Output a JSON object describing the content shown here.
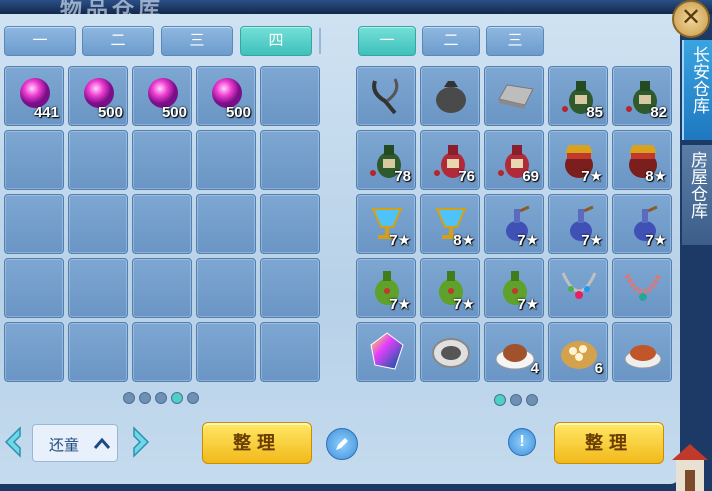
{
  "window": {
    "title": "物品仓库",
    "close_label": "✕"
  },
  "colors": {
    "tab_active": "#3fc0bb",
    "button_gold": "#f2b91b",
    "panel": "#c5dbee"
  },
  "left_tabs": [
    {
      "label": "一",
      "active": false
    },
    {
      "label": "二",
      "active": false
    },
    {
      "label": "三",
      "active": false
    },
    {
      "label": "四",
      "active": true
    }
  ],
  "right_tabs": [
    {
      "label": "一",
      "active": true
    },
    {
      "label": "二",
      "active": false
    },
    {
      "label": "三",
      "active": false
    }
  ],
  "left_grid": [
    {
      "icon": "magenta-gem-orb-icon",
      "count": "441"
    },
    {
      "icon": "magenta-gem-orb-icon",
      "count": "500"
    },
    {
      "icon": "magenta-gem-orb-icon",
      "count": "500"
    },
    {
      "icon": "magenta-gem-orb-icon",
      "count": "500"
    },
    {
      "icon": "",
      "count": ""
    },
    {
      "icon": "",
      "count": ""
    },
    {
      "icon": "",
      "count": ""
    },
    {
      "icon": "",
      "count": ""
    },
    {
      "icon": "",
      "count": ""
    },
    {
      "icon": "",
      "count": ""
    },
    {
      "icon": "",
      "count": ""
    },
    {
      "icon": "",
      "count": ""
    },
    {
      "icon": "",
      "count": ""
    },
    {
      "icon": "",
      "count": ""
    },
    {
      "icon": "",
      "count": ""
    },
    {
      "icon": "",
      "count": ""
    },
    {
      "icon": "",
      "count": ""
    },
    {
      "icon": "",
      "count": ""
    },
    {
      "icon": "",
      "count": ""
    },
    {
      "icon": "",
      "count": ""
    },
    {
      "icon": "",
      "count": ""
    },
    {
      "icon": "",
      "count": ""
    },
    {
      "icon": "",
      "count": ""
    },
    {
      "icon": "",
      "count": ""
    },
    {
      "icon": "",
      "count": ""
    }
  ],
  "right_grid": [
    {
      "icon": "slingshot-icon",
      "count": ""
    },
    {
      "icon": "cloth-pouch-icon",
      "count": ""
    },
    {
      "icon": "silver-bar-icon",
      "count": ""
    },
    {
      "icon": "green-wine-jar-icon",
      "count": "85"
    },
    {
      "icon": "green-wine-jar-icon",
      "count": "82"
    },
    {
      "icon": "green-wine-jar-icon",
      "count": "78"
    },
    {
      "icon": "red-wine-jar-icon",
      "count": "76"
    },
    {
      "icon": "red-wine-jar-icon",
      "count": "69"
    },
    {
      "icon": "sealed-red-jar-icon",
      "count": "7★"
    },
    {
      "icon": "sealed-red-jar-icon",
      "count": "8★"
    },
    {
      "icon": "crystal-chalice-icon",
      "count": "7★"
    },
    {
      "icon": "crystal-chalice-icon",
      "count": "8★"
    },
    {
      "icon": "blue-potion-bottle-icon",
      "count": "7★"
    },
    {
      "icon": "blue-potion-bottle-icon",
      "count": "7★"
    },
    {
      "icon": "blue-potion-bottle-icon",
      "count": "7★"
    },
    {
      "icon": "green-vase-icon",
      "count": "7★"
    },
    {
      "icon": "green-vase-icon",
      "count": "7★"
    },
    {
      "icon": "green-vase-icon",
      "count": "7★"
    },
    {
      "icon": "jeweled-necklace-icon",
      "count": ""
    },
    {
      "icon": "beaded-necklace-icon",
      "count": ""
    },
    {
      "icon": "rainbow-crystal-icon",
      "count": ""
    },
    {
      "icon": "silver-plate-icon",
      "count": ""
    },
    {
      "icon": "roast-duck-plate-icon",
      "count": "4"
    },
    {
      "icon": "dumpling-steamer-icon",
      "count": "6"
    },
    {
      "icon": "roast-chicken-icon",
      "count": ""
    }
  ],
  "left_pages": {
    "total": 5,
    "current": 4
  },
  "right_pages": {
    "total": 3,
    "current": 1
  },
  "bottom": {
    "select_value": "还童",
    "sort_label_left": "整理",
    "sort_label_right": "整理",
    "info_icon": "!"
  },
  "side_tabs": [
    {
      "label": "长安仓库",
      "active": true
    },
    {
      "label": "房屋仓库",
      "active": false
    }
  ]
}
